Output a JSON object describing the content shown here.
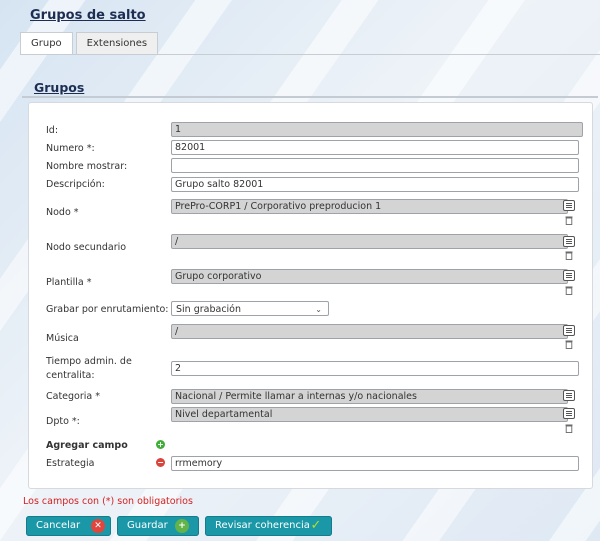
{
  "page_title": "Grupos de salto",
  "tabs": [
    {
      "label": "Grupo",
      "active": true
    },
    {
      "label": "Extensiones",
      "active": false
    }
  ],
  "section_title": "Grupos",
  "form": {
    "id": {
      "label": "Id:",
      "value": "1"
    },
    "numero": {
      "label": "Numero *:",
      "value": "82001"
    },
    "nombre_mostrar": {
      "label": "Nombre mostrar:",
      "value": ""
    },
    "descripcion": {
      "label": "Descripción:",
      "value": "Grupo salto 82001"
    },
    "nodo": {
      "label": "Nodo *",
      "value": "PrePro-CORP1 / Corporativo preproducion 1"
    },
    "nodo_secundario": {
      "label": "Nodo secundario",
      "value": "/"
    },
    "plantilla": {
      "label": "Plantilla *",
      "value": "Grupo corporativo"
    },
    "grabar": {
      "label": "Grabar por enrutamiento:",
      "value": "Sin grabación"
    },
    "musica": {
      "label": "Música",
      "value": "/"
    },
    "tiempo_line1": "Tiempo admin. de",
    "tiempo_line2": "centralita:",
    "tiempo_value": "2",
    "categoria": {
      "label": "Categoria *",
      "value": "Nacional / Permite llamar a internas y/o nacionales"
    },
    "dpto": {
      "label": "Dpto *:",
      "value": "Nivel departamental"
    },
    "agregar_campo": "Agregar campo",
    "estrategia": {
      "label": "Estrategia",
      "value": "rrmemory"
    }
  },
  "required_note": "Los campos con (*) son obligatorios",
  "buttons": {
    "cancelar": "Cancelar",
    "guardar": "Guardar",
    "revisar": "Revisar coherencia"
  },
  "colors": {
    "button": "#1a98a8",
    "note": "#d42020",
    "title": "#1d2e52"
  }
}
